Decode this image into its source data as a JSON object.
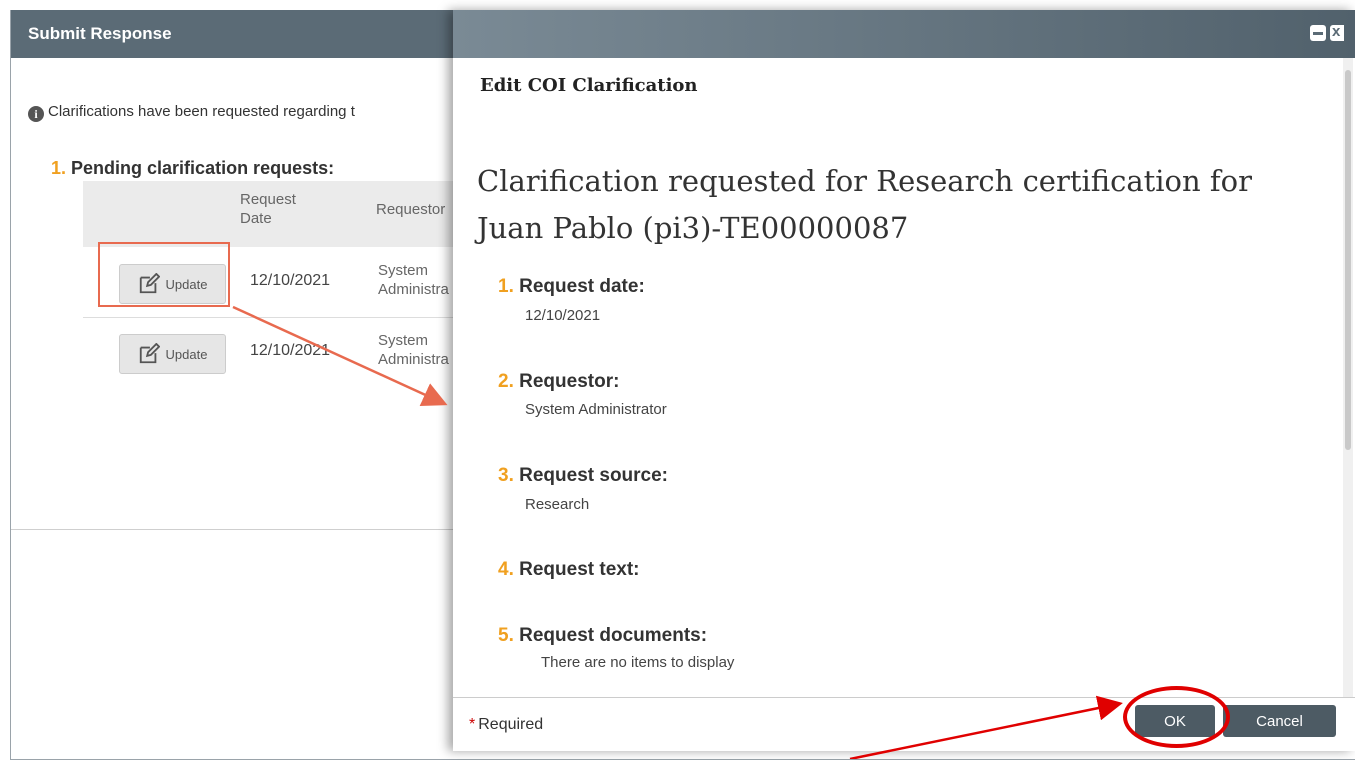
{
  "background_dialog": {
    "title": "Submit Response",
    "info_text": "Clarifications have been requested regarding t",
    "section": {
      "number": "1.",
      "title": "Pending clarification requests:"
    },
    "table": {
      "headers": {
        "request_date": "Request Date",
        "requestor": "Requestor"
      },
      "rows": [
        {
          "button": "Update",
          "date": "12/10/2021",
          "requestor": "System Administra"
        },
        {
          "button": "Update",
          "date": "12/10/2021",
          "requestor": "System Administra"
        }
      ]
    }
  },
  "modal": {
    "title": "Edit COI Clarification",
    "heading": "Clarification requested for  Research certification for Juan Pablo (pi3)-TE00000087",
    "fields": [
      {
        "num": "1.",
        "label": "Request date:",
        "value": "12/10/2021"
      },
      {
        "num": "2.",
        "label": "Requestor:",
        "value": "System Administrator"
      },
      {
        "num": "3.",
        "label": "Request source:",
        "value": "Research"
      },
      {
        "num": "4.",
        "label": "Request text:",
        "value": ""
      },
      {
        "num": "5.",
        "label": "Request documents:",
        "value": "There are no items to display"
      }
    ],
    "footer": {
      "required_star": "*",
      "required_label": "Required",
      "ok": "OK",
      "cancel": "Cancel"
    }
  },
  "colors": {
    "header_bg": "#5b6b76",
    "button_dark": "#4d5b64",
    "number_accent": "#f0a020",
    "annotation_red": "#e00000",
    "annotation_orange": "#e86a4f"
  },
  "icons": [
    "info-icon",
    "edit-icon",
    "minimize-icon",
    "close-icon"
  ]
}
